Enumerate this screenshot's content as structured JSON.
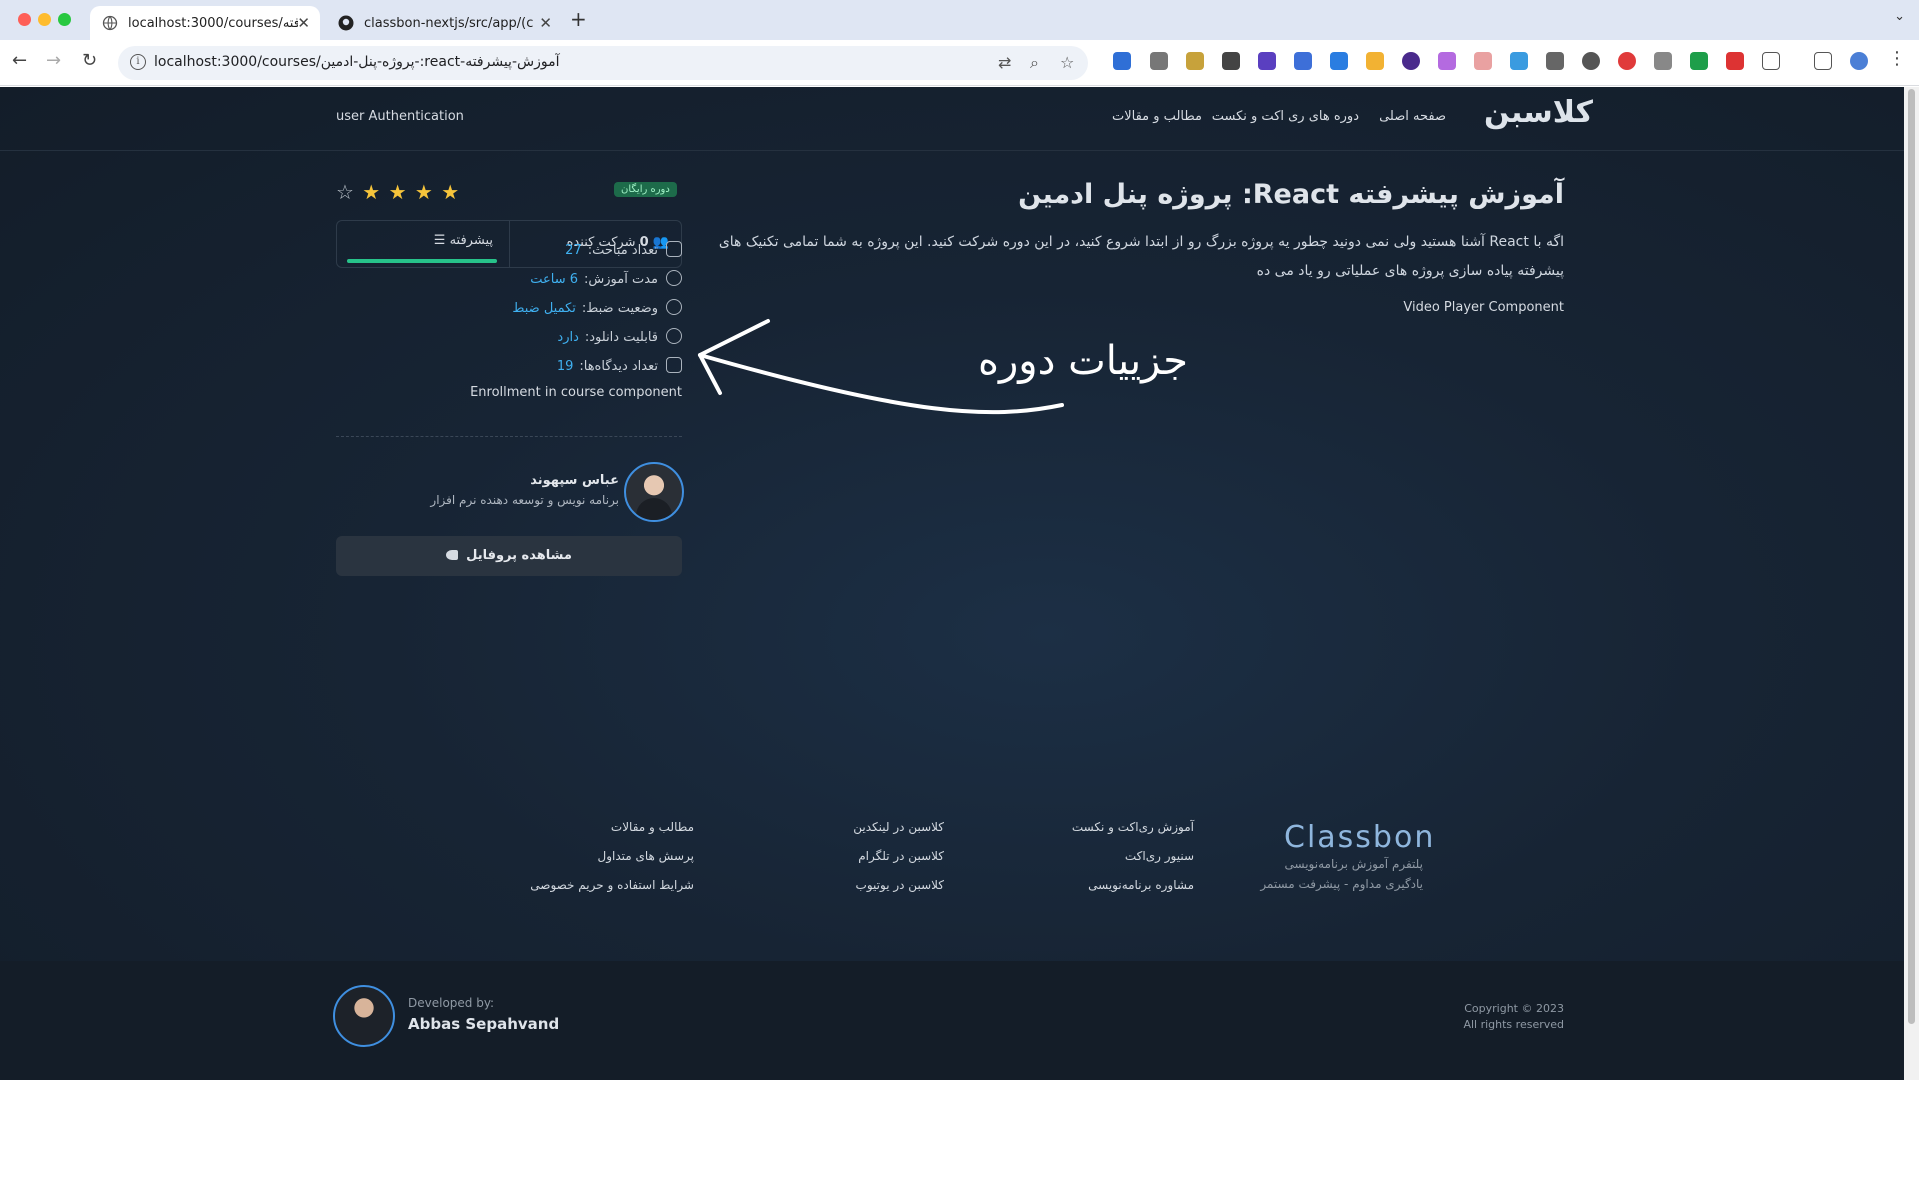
{
  "browser": {
    "tabs": [
      {
        "title": "localhost:3000/courses/پیشرفته"
      },
      {
        "title": "classbon-nextjs/src/app/(cou"
      }
    ],
    "new_tab": "+",
    "url": "localhost:3000/courses/پروژه-پنل-ادمین-:react-آموزش-پیشرفته"
  },
  "header": {
    "logo": "کلاسبن",
    "nav": [
      "صفحه اصلی",
      "دوره های ری اکت و نکست",
      "مطالب و مقالات"
    ],
    "user_auth": "user Authentication"
  },
  "course": {
    "title": "آموزش پیشرفته React: پروژه پنل ادمین",
    "description": "اگه با React آشنا هستید ولی نمی دونید چطور یه پروژه بزرگ رو از ابتدا شروع کنید، در این دوره شرکت کنید. این پروژه به شما تمامی تکنیک های پیشرفته پیاده سازی پروژه های عملیاتی رو یاد می ده",
    "video_placeholder": "Video Player Component",
    "badge": "دوره رایگان",
    "rating": 4,
    "rating_max": 5,
    "participants_label": "شرکت کننده",
    "participants_count": "0",
    "level_label": "پیشرفته",
    "level_progress": 1.0,
    "details": [
      {
        "label": "تعداد مباحث:",
        "value": "27"
      },
      {
        "label": "مدت آموزش:",
        "value": "6 ساعت"
      },
      {
        "label": "وضعیت ضبط:",
        "value": "تکمیل ضبط"
      },
      {
        "label": "قابلیت دانلود:",
        "value": "دارد"
      },
      {
        "label": "تعداد دیدگاه‌ها:",
        "value": "19"
      }
    ],
    "enrollment_placeholder": "Enrollment in course component",
    "instructor": {
      "name": "عباس سپهوند",
      "role": "برنامه نویس و توسعه دهنده نرم افزار"
    },
    "profile_button": "مشاهده پروفایل"
  },
  "annotation": {
    "text": "جزییات دوره"
  },
  "footer": {
    "logo": "Classbon",
    "tagline": [
      "پلتفرم آموزش برنامه‌نویسی",
      "یادگیری مداوم - پیشرفت مستمر"
    ],
    "col1": [
      "آموزش ری‌اکت و نکست",
      "سنیور ری‌اکت",
      "مشاوره برنامه‌نویسی"
    ],
    "col2": [
      "کلاسبن در لینکدین",
      "کلاسبن در تلگرام",
      "کلاسبن در یوتیوب"
    ],
    "col3": [
      "مطالب و مقالات",
      "پرسش های متداول",
      "شرایط استفاده و حریم خصوصی"
    ],
    "developed_by_label": "Developed by:",
    "developer_name": "Abbas Sepahvand",
    "copyright_line1": "Copyright © 2023",
    "copyright_line2": "All rights reserved"
  },
  "colors": {
    "accent_blue": "#3fb0f0",
    "star": "#f6c43b",
    "progress": "#27c38a",
    "badge_bg": "#1d6b4a"
  }
}
